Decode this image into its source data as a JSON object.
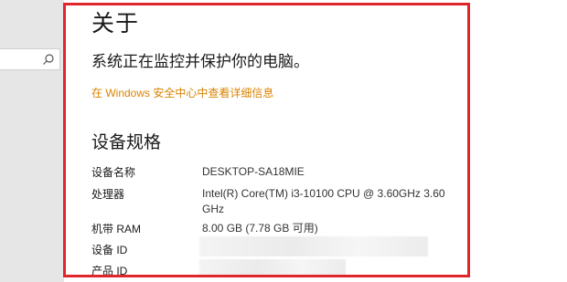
{
  "page": {
    "title": "关于",
    "subtitle": "系统正在监控并保护你的电脑。",
    "security_link": "在 Windows 安全中心中查看详细信息",
    "section_title": "设备规格"
  },
  "specs": [
    {
      "label": "设备名称",
      "value": "DESKTOP-SA18MIE"
    },
    {
      "label": "处理器",
      "value": "Intel(R) Core(TM) i3-10100 CPU @ 3.60GHz   3.60 GHz"
    },
    {
      "label": "机带 RAM",
      "value": "8.00 GB (7.78 GB 可用)"
    },
    {
      "label": "设备 ID",
      "value": ""
    },
    {
      "label": "产品 ID",
      "value": ""
    }
  ],
  "colors": {
    "accent_link": "#d98300",
    "highlight_border": "#e0262b"
  },
  "icons": {
    "search": "search-icon"
  }
}
